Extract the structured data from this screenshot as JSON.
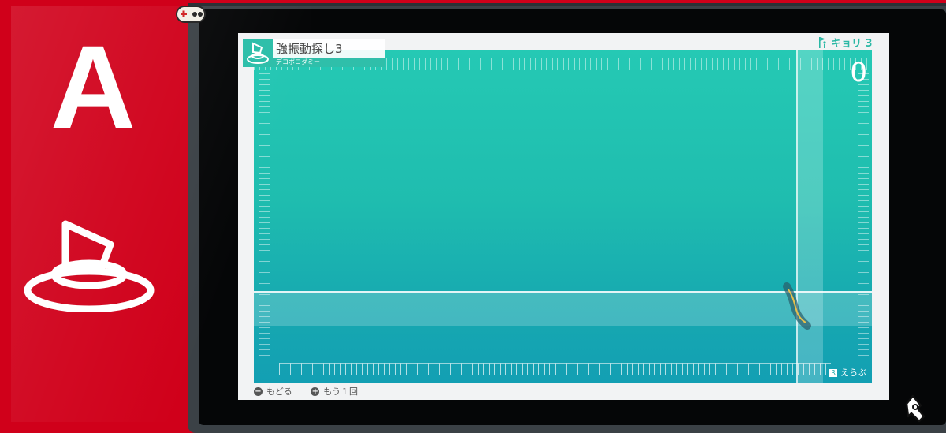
{
  "side_panel": {
    "letter": "A",
    "mode_icon": "sonar-fish-icon"
  },
  "game": {
    "title": "強振動探し3",
    "subtitle": "デコボコダミー",
    "distance_label": "キョリ 3",
    "score": "0",
    "select_hint": "えらぶ",
    "select_button": "R"
  },
  "footer": {
    "back_label": "もどる",
    "back_button": "−",
    "retry_label": "もう１回",
    "retry_button": "+"
  },
  "colors": {
    "background_red": "#d0001a",
    "sonar_teal": "#1fbdaf",
    "accent": "#2bb8a5"
  },
  "icons": {
    "top_left": "joycon-icon",
    "bottom_right": "pointer-hand-icon"
  }
}
